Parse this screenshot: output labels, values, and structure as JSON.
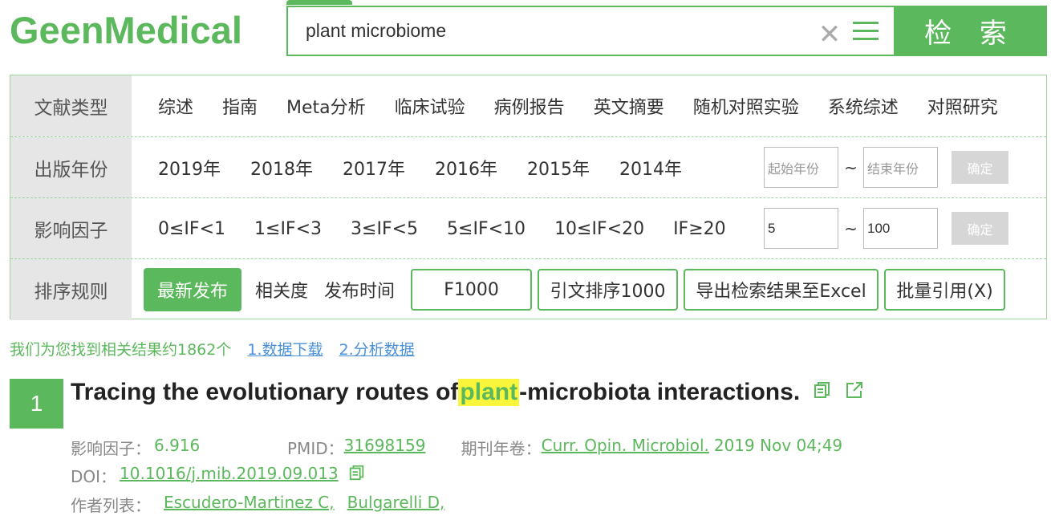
{
  "header": {
    "logo": "GeenMedical",
    "search_value": "plant microbiome",
    "search_button": "检 索"
  },
  "filters": {
    "doc_type": {
      "label": "文献类型",
      "items": [
        "综述",
        "指南",
        "Meta分析",
        "临床试验",
        "病例报告",
        "英文摘要",
        "随机对照实验",
        "系统综述",
        "对照研究"
      ]
    },
    "year": {
      "label": "出版年份",
      "items": [
        "2019年",
        "2018年",
        "2017年",
        "2016年",
        "2015年",
        "2014年"
      ],
      "start_placeholder": "起始年份",
      "end_placeholder": "结束年份",
      "tilde": "~",
      "ok": "确定"
    },
    "impact": {
      "label": "影响因子",
      "items": [
        "0≤IF<1",
        "1≤IF<3",
        "3≤IF<5",
        "5≤IF<10",
        "10≤IF<20",
        "IF≥20"
      ],
      "min_value": "5",
      "max_value": "100",
      "tilde": "~",
      "ok": "确定"
    },
    "sort": {
      "label": "排序规则",
      "active": "最新发布",
      "relevance": "相关度",
      "pub_time": "发布时间",
      "f1000": "F1000",
      "citation": "引文排序1000",
      "export": "导出检索结果至Excel",
      "batch_cite": "批量引用(X)"
    }
  },
  "results": {
    "summary": "我们为您找到相关结果约1862个",
    "link1": "1.数据下载",
    "link2": "2.分析数据",
    "items": [
      {
        "index": "1",
        "title_pre": "Tracing the evolutionary routes of ",
        "title_hl": "plant",
        "title_post": "-microbiota interactions.",
        "if_label": "影响因子：",
        "if_value": "6.916",
        "pmid_label": "PMID：",
        "pmid_value": "31698159",
        "journal_label": "期刊年卷：",
        "journal_value": "Curr. Opin. Microbiol.",
        "journal_date": "2019 Nov 04;49",
        "doi_label": "DOI：",
        "doi_value": "10.1016/j.mib.2019.09.013",
        "authors_label": "作者列表：",
        "authors": [
          "Escudero-Martinez C,",
          "Bulgarelli D,"
        ]
      }
    ]
  },
  "colors": {
    "accent": "#5cb85c",
    "link": "#4a90d9",
    "highlight": "#f9f53b"
  }
}
